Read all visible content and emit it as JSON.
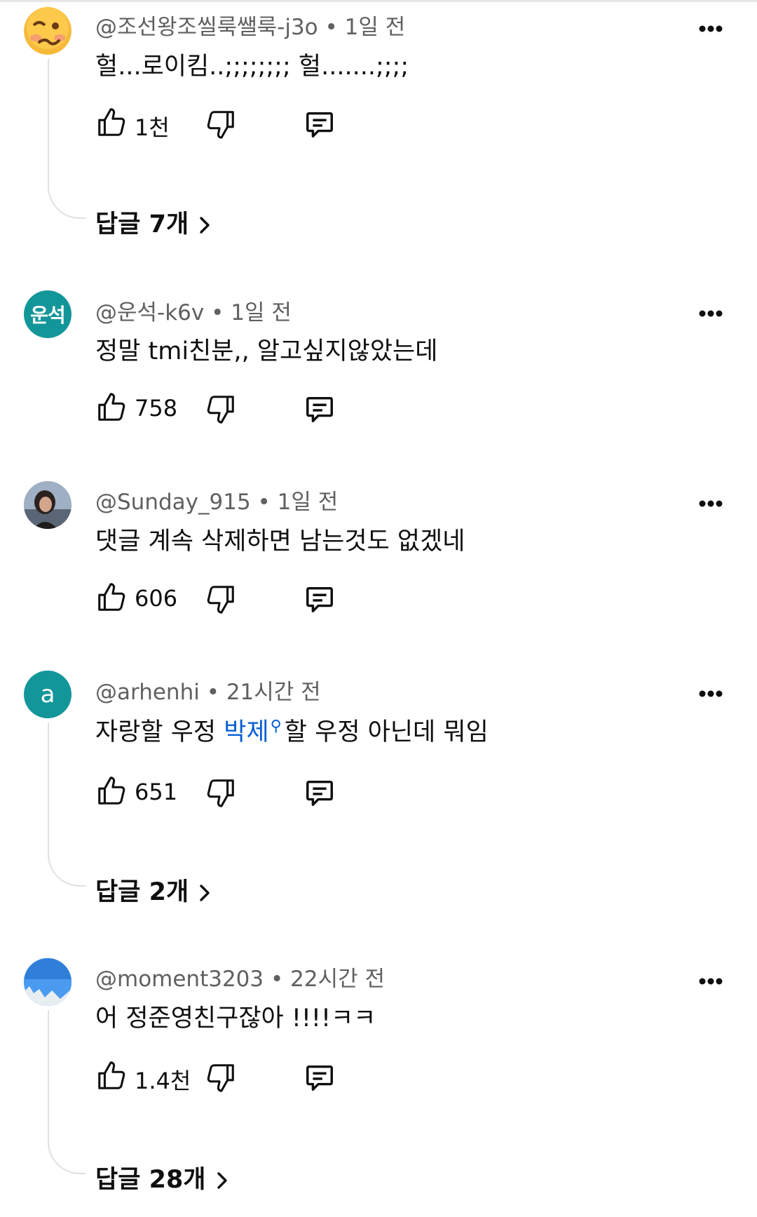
{
  "comments": [
    {
      "handle": "@조선왕조씰룩쌜룩-j3o",
      "time": "1일 전",
      "text": "헐...로이킴..;;;;;;;; 헐.......;;;;",
      "likes": "1천",
      "replies_label": "답글 7개",
      "avatar": {
        "type": "emoji",
        "color": "#f7b93a"
      }
    },
    {
      "handle": "@운석-k6v",
      "time": "1일 전",
      "text": "정말 tmi친분,, 알고싶지않았는데",
      "likes": "758",
      "avatar": {
        "type": "text",
        "label": "운석",
        "color": "#13969a"
      }
    },
    {
      "handle": "@Sunday_915",
      "time": "1일 전",
      "text": "댓글 계속 삭제하면 남는것도 없겠네",
      "likes": "606",
      "avatar": {
        "type": "photo",
        "color": "#7f8fa3"
      }
    },
    {
      "handle": "@arhenhi",
      "time": "21시간 전",
      "text_before": "자랑할 우정 ",
      "text_link": "박제",
      "text_after": "할 우정 아닌데 뭐임",
      "likes": "651",
      "replies_label": "답글 2개",
      "avatar": {
        "type": "letter",
        "label": "a",
        "color": "#13969a"
      }
    },
    {
      "handle": "@moment3203",
      "time": "22시간 전",
      "text": "어 정준영친구잖아 !!!!ㅋㅋ",
      "likes": "1.4천",
      "replies_label": "답글 28개",
      "avatar": {
        "type": "photo",
        "color": "#3d8fe6"
      }
    }
  ],
  "colors": {
    "link": "#065fd4",
    "meta": "#606060",
    "text": "#0f0f0f",
    "thread_line": "#e0e0e0"
  },
  "icons": [
    "thumb-up-icon",
    "thumb-down-icon",
    "reply-icon",
    "more-icon",
    "chevron-right-icon"
  ]
}
